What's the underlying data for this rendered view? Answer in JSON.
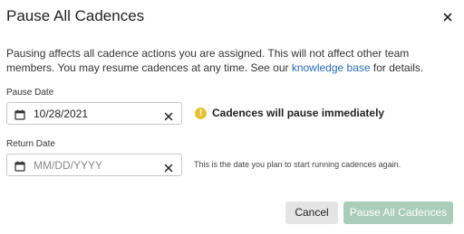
{
  "dialog": {
    "title": "Pause All Cadences",
    "description_before_link": "Pausing affects all cadence actions you are assigned. This will not affect other team members. You may resume cadences at any time. See our ",
    "link_text": "knowledge base",
    "description_after_link": " for details."
  },
  "pause_date": {
    "label": "Pause Date",
    "value": "10/28/2021",
    "status_text": "Cadences will pause immediately"
  },
  "return_date": {
    "label": "Return Date",
    "placeholder": "MM/DD/YYYY",
    "hint": "This is the date you plan to start running cadences again."
  },
  "buttons": {
    "cancel": "Cancel",
    "pause_all": "Pause All Cadences"
  },
  "icons": {
    "close": "close-icon",
    "calendar": "calendar-icon",
    "clear": "clear-icon",
    "warning": "warning-icon"
  },
  "colors": {
    "link": "#2a6ab5",
    "warning": "#e5c233",
    "primary_disabled": "#a9cdb8",
    "secondary_button": "#e4e4e4"
  }
}
